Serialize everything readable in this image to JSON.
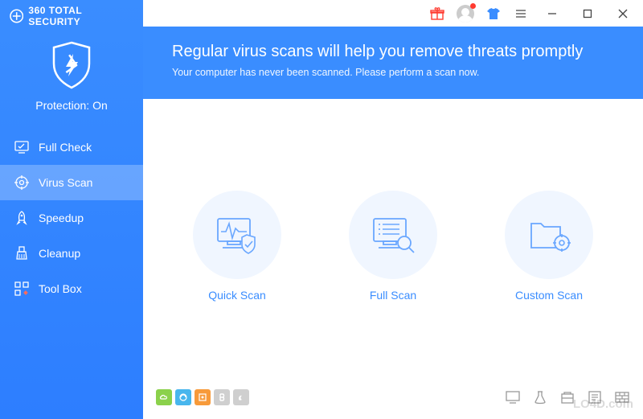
{
  "brand": "360 TOTAL SECURITY",
  "protection_status": "Protection: On",
  "sidebar": {
    "items": [
      {
        "label": "Full Check"
      },
      {
        "label": "Virus Scan"
      },
      {
        "label": "Speedup"
      },
      {
        "label": "Cleanup"
      },
      {
        "label": "Tool Box"
      }
    ],
    "active_index": 1
  },
  "header": {
    "title": "Regular virus scans will help you remove threats promptly",
    "subtitle": "Your computer has never been scanned. Please perform a scan now."
  },
  "scans": [
    {
      "label": "Quick Scan"
    },
    {
      "label": "Full Scan"
    },
    {
      "label": "Custom Scan"
    }
  ],
  "watermark": "LO4D.com"
}
